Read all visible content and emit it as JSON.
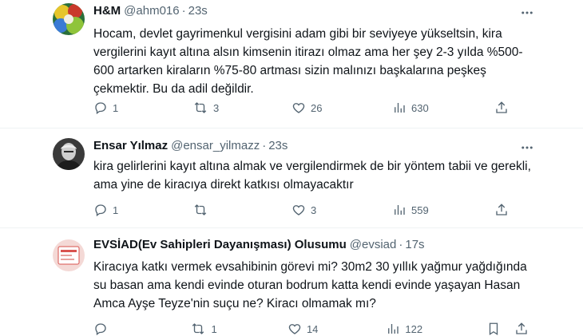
{
  "tweets": [
    {
      "name": "H&M",
      "handle": "@ahm016",
      "time": "23s",
      "text": "Hocam, devlet gayrimenkul vergisini adam gibi bir seviyeye yükseltsin, kira vergilerini kayıt altına alsın kimsenin itirazı olmaz ama her şey 2-3 yılda %500-600 artarken kiraların %75-80 artması sizin malınızı başkalarına peşkeş çekmektir. Bu da adil değildir.",
      "replies": "1",
      "retweets": "3",
      "likes": "26",
      "views": "630"
    },
    {
      "name": "Ensar Yılmaz",
      "handle": "@ensar_yilmazz",
      "time": "23s",
      "text": "kira gelirlerini kayıt altına almak ve vergilendirmek de bir yöntem tabii ve gerekli, ama yine de kiracıya direkt katkısı olmayacaktır",
      "replies": "1",
      "retweets": "",
      "likes": "3",
      "views": "559"
    },
    {
      "name": "EVSİAD(Ev Sahipleri Dayanışması) Olusumu",
      "handle": "@evsiad",
      "time": "17s",
      "text": "Kiracıya katkı vermek evsahibinin görevi mi? 30m2 30 yıllık yağmur yağdığında su basan ama kendi evinde oturan bodrum katta kendi evinde yaşayan Hasan Amca Ayşe Teyze'nin suçu ne? Kiracı olmamak mı?",
      "replies": "",
      "retweets": "1",
      "likes": "14",
      "views": "122"
    }
  ],
  "separator": "·",
  "icons": {
    "reply": "reply-icon",
    "retweet": "retweet-icon",
    "like": "heart-icon",
    "views": "views-icon",
    "share": "share-icon",
    "bookmark": "bookmark-icon",
    "more": "more-icon"
  },
  "colors": {
    "text": "#0f1419",
    "secondary": "#536471",
    "divider": "#eff3f4"
  }
}
